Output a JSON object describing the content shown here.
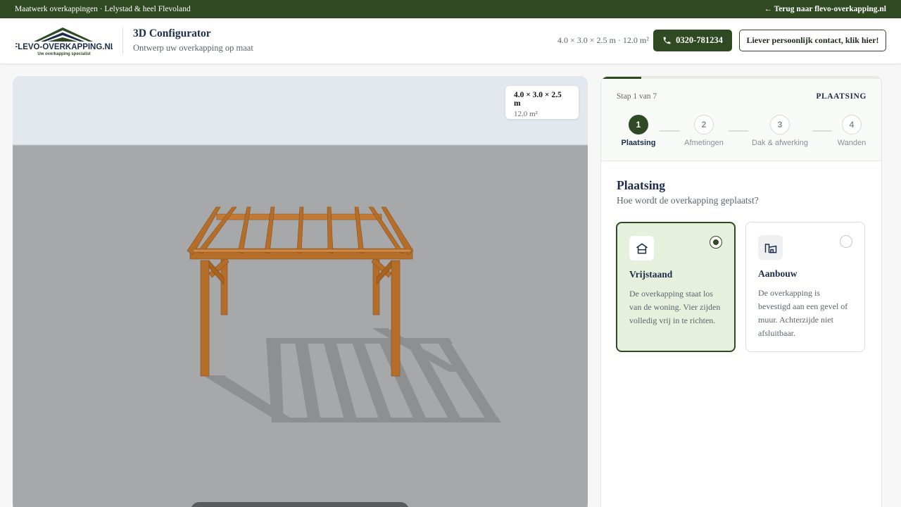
{
  "topbar": {
    "tagline": "Maatwerk overkappingen · Lelystad & heel Flevoland",
    "back_link": "← Terug naar flevo-overkapping.nl"
  },
  "header": {
    "logo_text": "FLEVO-OVERKAPPING.NL",
    "logo_tagline": "Uw overkapping specialist",
    "title": "3D Configurator",
    "subtitle": "Ontwerp uw overkapping op maat",
    "dimensions_summary": "4.0 × 3.0 × 2.5 m · 12.0 m²",
    "phone_label": "0320-781234",
    "contact_label": "Liever persoonlijk contact, klik hier!"
  },
  "viewer": {
    "dimensions": "4.0 × 3.0 × 2.5 m",
    "area": "12.0 m²"
  },
  "wizard": {
    "progress_fraction": 0.143,
    "step_counter": "Stap 1 van 7",
    "current_step_name": "PLAATSING",
    "steps": [
      {
        "number": "1",
        "label": "Plaatsing",
        "active": true
      },
      {
        "number": "2",
        "label": "Afmetingen",
        "active": false
      },
      {
        "number": "3",
        "label": "Dak & afwerking",
        "active": false
      },
      {
        "number": "4",
        "label": "Wanden",
        "active": false
      }
    ],
    "section_title": "Plaatsing",
    "section_question": "Hoe wordt de overkapping geplaatst?",
    "options": [
      {
        "icon": "house-icon",
        "title": "Vrijstaand",
        "description": "De overkapping staat los van de woning. Vier zijden volledig vrij in te richten.",
        "selected": true
      },
      {
        "icon": "attached-building-icon",
        "title": "Aanbouw",
        "description": "De overkapping is bevestigd aan een gevel of muur. Achterzijde niet afsluitbaar.",
        "selected": false
      }
    ]
  },
  "colors": {
    "brand_green": "#2f4a22",
    "selected_bg": "#e6f0dd",
    "wood": "#b56e2a"
  }
}
